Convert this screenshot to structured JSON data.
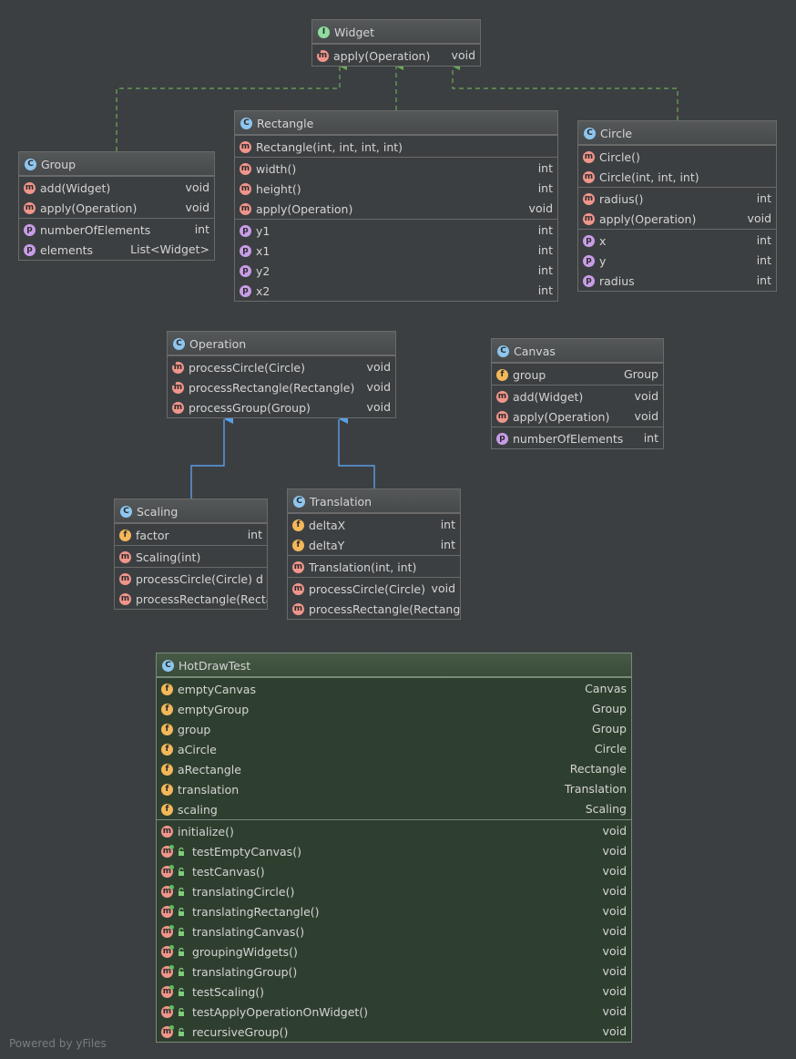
{
  "footer": "Powered by yFiles",
  "colors": {
    "background": "#3c3f41",
    "implements_edge": "#6aaa5a",
    "extends_edge": "#5a9ee8",
    "test_class_bg": "#2f3f2f"
  },
  "nodes": [
    {
      "id": "widget",
      "name": "Widget",
      "kind": "interface",
      "sections": [
        [
          {
            "icon": "abstract-method",
            "name": "apply(Operation)",
            "type": "void"
          }
        ]
      ]
    },
    {
      "id": "group",
      "name": "Group",
      "kind": "class",
      "sections": [
        [
          {
            "icon": "method",
            "name": "add(Widget)",
            "type": "void"
          },
          {
            "icon": "method",
            "name": "apply(Operation)",
            "type": "void"
          }
        ],
        [
          {
            "icon": "property",
            "name": "numberOfElements",
            "type": "int"
          },
          {
            "icon": "property",
            "name": "elements",
            "type": "List<Widget>"
          }
        ]
      ]
    },
    {
      "id": "rectangle",
      "name": "Rectangle",
      "kind": "class",
      "sections": [
        [
          {
            "icon": "method",
            "name": "Rectangle(int, int, int, int)",
            "type": ""
          }
        ],
        [
          {
            "icon": "method",
            "name": "width()",
            "type": "int"
          },
          {
            "icon": "method",
            "name": "height()",
            "type": "int"
          },
          {
            "icon": "method",
            "name": "apply(Operation)",
            "type": "void"
          }
        ],
        [
          {
            "icon": "property",
            "name": "y1",
            "type": "int"
          },
          {
            "icon": "property",
            "name": "x1",
            "type": "int"
          },
          {
            "icon": "property",
            "name": "y2",
            "type": "int"
          },
          {
            "icon": "property",
            "name": "x2",
            "type": "int"
          }
        ]
      ]
    },
    {
      "id": "circle",
      "name": "Circle",
      "kind": "class",
      "sections": [
        [
          {
            "icon": "method",
            "name": "Circle()",
            "type": ""
          },
          {
            "icon": "method",
            "name": "Circle(int, int, int)",
            "type": ""
          }
        ],
        [
          {
            "icon": "method",
            "name": "radius()",
            "type": "int"
          },
          {
            "icon": "method",
            "name": "apply(Operation)",
            "type": "void"
          }
        ],
        [
          {
            "icon": "property",
            "name": "x",
            "type": "int"
          },
          {
            "icon": "property",
            "name": "y",
            "type": "int"
          },
          {
            "icon": "property",
            "name": "radius",
            "type": "int"
          }
        ]
      ]
    },
    {
      "id": "operation",
      "name": "Operation",
      "kind": "abstract-class",
      "sections": [
        [
          {
            "icon": "abstract-method",
            "name": "processCircle(Circle)",
            "type": "void"
          },
          {
            "icon": "abstract-method",
            "name": "processRectangle(Rectangle)",
            "type": "void"
          },
          {
            "icon": "method",
            "name": "processGroup(Group)",
            "type": "void"
          }
        ]
      ]
    },
    {
      "id": "canvas",
      "name": "Canvas",
      "kind": "class",
      "sections": [
        [
          {
            "icon": "field",
            "name": "group",
            "type": "Group"
          }
        ],
        [
          {
            "icon": "method",
            "name": "add(Widget)",
            "type": "void"
          },
          {
            "icon": "method",
            "name": "apply(Operation)",
            "type": "void"
          }
        ],
        [
          {
            "icon": "property",
            "name": "numberOfElements",
            "type": "int"
          }
        ]
      ]
    },
    {
      "id": "scaling",
      "name": "Scaling",
      "kind": "class",
      "sections": [
        [
          {
            "icon": "field",
            "name": "factor",
            "type": "int"
          }
        ],
        [
          {
            "icon": "method",
            "name": "Scaling(int)",
            "type": ""
          }
        ],
        [
          {
            "icon": "method",
            "name": "processCircle(Circle) d",
            "type": ""
          },
          {
            "icon": "method",
            "name": "processRectangle(Recta",
            "type": ""
          }
        ]
      ]
    },
    {
      "id": "translation",
      "name": "Translation",
      "kind": "class",
      "sections": [
        [
          {
            "icon": "field",
            "name": "deltaX",
            "type": "int"
          },
          {
            "icon": "field",
            "name": "deltaY",
            "type": "int"
          }
        ],
        [
          {
            "icon": "method",
            "name": "Translation(int, int)",
            "type": ""
          }
        ],
        [
          {
            "icon": "method",
            "name": "processCircle(Circle)",
            "type": "void"
          },
          {
            "icon": "method",
            "name": "processRectangle(Rectangl",
            "type": ""
          }
        ]
      ]
    },
    {
      "id": "hotdrawtest",
      "name": "HotDrawTest",
      "kind": "test-class",
      "sections": [
        [
          {
            "icon": "field",
            "name": "emptyCanvas",
            "type": "Canvas"
          },
          {
            "icon": "field",
            "name": "emptyGroup",
            "type": "Group"
          },
          {
            "icon": "field",
            "name": "group",
            "type": "Group"
          },
          {
            "icon": "field",
            "name": "aCircle",
            "type": "Circle"
          },
          {
            "icon": "field",
            "name": "aRectangle",
            "type": "Rectangle"
          },
          {
            "icon": "field",
            "name": "translation",
            "type": "Translation"
          },
          {
            "icon": "field",
            "name": "scaling",
            "type": "Scaling"
          }
        ],
        [
          {
            "icon": "method",
            "name": "initialize()",
            "type": "void"
          },
          {
            "icon": "test-method",
            "name": "testEmptyCanvas()",
            "type": "void"
          },
          {
            "icon": "test-method",
            "name": "testCanvas()",
            "type": "void"
          },
          {
            "icon": "test-method",
            "name": "translatingCircle()",
            "type": "void"
          },
          {
            "icon": "test-method",
            "name": "translatingRectangle()",
            "type": "void"
          },
          {
            "icon": "test-method",
            "name": "translatingCanvas()",
            "type": "void"
          },
          {
            "icon": "test-method",
            "name": "groupingWidgets()",
            "type": "void"
          },
          {
            "icon": "test-method",
            "name": "translatingGroup()",
            "type": "void"
          },
          {
            "icon": "test-method",
            "name": "testScaling()",
            "type": "void"
          },
          {
            "icon": "test-method",
            "name": "testApplyOperationOnWidget()",
            "type": "void"
          },
          {
            "icon": "test-method",
            "name": "recursiveGroup()",
            "type": "void"
          }
        ]
      ]
    }
  ],
  "edges": [
    {
      "from": "group",
      "to": "widget",
      "kind": "implements"
    },
    {
      "from": "rectangle",
      "to": "widget",
      "kind": "implements"
    },
    {
      "from": "circle",
      "to": "widget",
      "kind": "implements"
    },
    {
      "from": "scaling",
      "to": "operation",
      "kind": "extends"
    },
    {
      "from": "translation",
      "to": "operation",
      "kind": "extends"
    }
  ]
}
